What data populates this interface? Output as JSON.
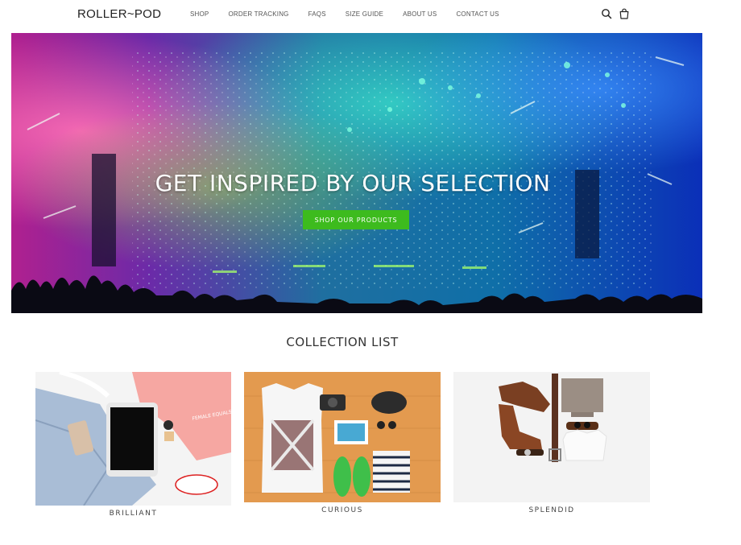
{
  "header": {
    "logo": "ROLLER~POD",
    "nav": [
      "SHOP",
      "ORDER TRACKING",
      "FAQS",
      "SIZE GUIDE",
      "ABOUT US",
      "CONTACT US"
    ],
    "search_icon": "search-icon",
    "cart_icon": "shopping-bag-icon"
  },
  "hero": {
    "title": "GET INSPIRED BY OUR SELECTION",
    "button_label": "SHOP OUR PRODUCTS",
    "button_color": "#3dbb1e"
  },
  "collection": {
    "title": "COLLECTION LIST",
    "items": [
      {
        "label": "BRILLIANT"
      },
      {
        "label": "CURIOUS"
      },
      {
        "label": "SPLENDID"
      }
    ]
  }
}
